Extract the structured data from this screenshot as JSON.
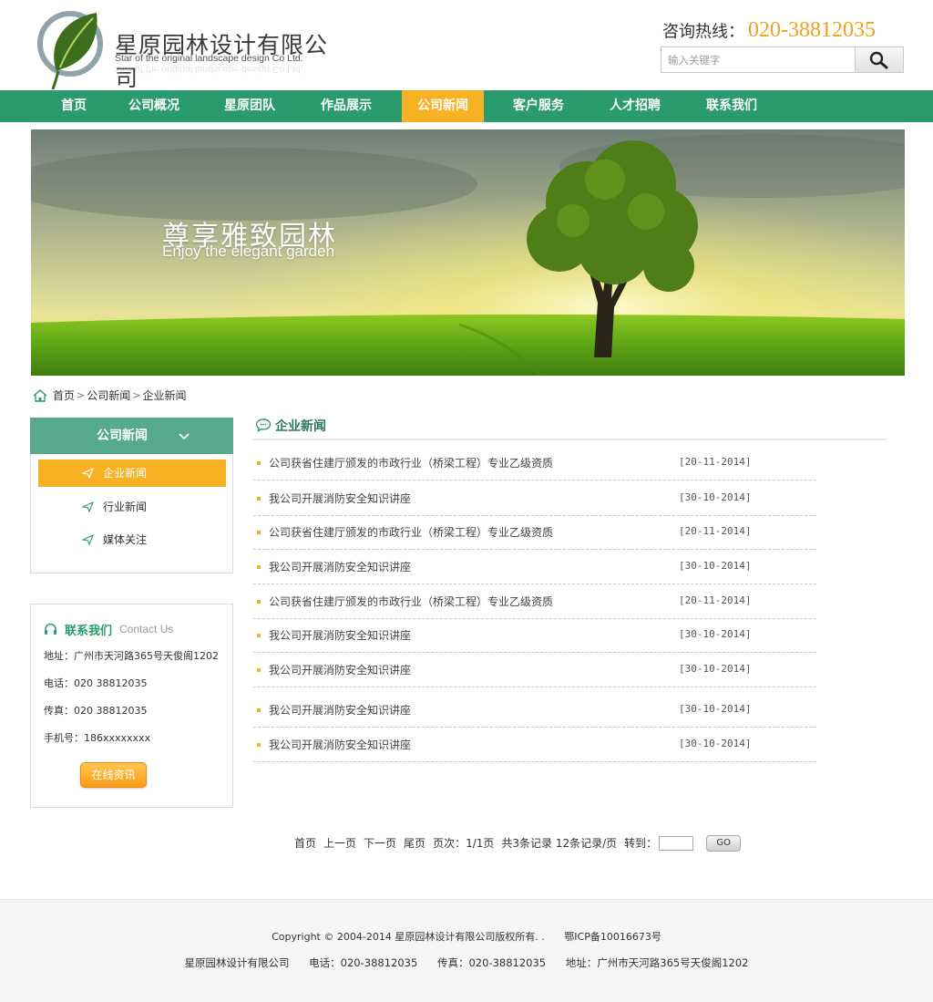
{
  "header": {
    "company_name": "星原园林设计有限公司",
    "company_name_en": "Star of the original landscape design Co Ltd.",
    "hotline_label": "咨询热线：",
    "hotline_number": "020-38812035",
    "search_placeholder": "输入关键字",
    "search_icon": "search-icon"
  },
  "nav": {
    "items": [
      {
        "label": "首页"
      },
      {
        "label": "公司概况"
      },
      {
        "label": "星原团队"
      },
      {
        "label": "作品展示"
      },
      {
        "label": "公司新闻"
      },
      {
        "label": "客户服务"
      },
      {
        "label": "人才招聘"
      },
      {
        "label": "联系我们"
      }
    ],
    "active_index": 4
  },
  "banner": {
    "title_cn": "尊享雅致园林",
    "title_en": "Enjoy the elegant garden"
  },
  "breadcrumb": {
    "items": [
      "首页",
      "公司新闻",
      "企业新闻"
    ]
  },
  "sidebar": {
    "category_title": "公司新闻",
    "categories": [
      {
        "label": "企业新闻"
      },
      {
        "label": "行业新闻"
      },
      {
        "label": "媒体关注"
      }
    ],
    "active_category": 0,
    "contact": {
      "title": "联系我们",
      "title_en": "Contact Us",
      "address": "地址：广州市天河路365号天俊阁1202",
      "phone": "电话：020 38812035",
      "fax": "传真：020 38812035",
      "mobile": "手机号：186xxxxxxxx",
      "consult_button": "在线资讯"
    }
  },
  "main": {
    "section_title": "企业新闻",
    "news": [
      {
        "title": "公司获省住建厅颁发的市政行业（桥梁工程）专业乙级资质",
        "date": "[20-11-2014]"
      },
      {
        "title": "我公司开展消防安全知识讲座",
        "date": "[30-10-2014]"
      },
      {
        "title": "公司获省住建厅颁发的市政行业（桥梁工程）专业乙级资质",
        "date": "[20-11-2014]"
      },
      {
        "title": "我公司开展消防安全知识讲座",
        "date": "[30-10-2014]"
      },
      {
        "title": "公司获省住建厅颁发的市政行业（桥梁工程）专业乙级资质",
        "date": "[20-11-2014]"
      },
      {
        "title": "我公司开展消防安全知识讲座",
        "date": "[30-10-2014]"
      },
      {
        "title": "我公司开展消防安全知识讲座",
        "date": "[30-10-2014]"
      },
      {
        "title": "我公司开展消防安全知识讲座",
        "date": "[30-10-2014]"
      },
      {
        "title": "我公司开展消防安全知识讲座",
        "date": "[30-10-2014]"
      }
    ]
  },
  "pagination": {
    "first": "首页",
    "prev": "上一页",
    "next": "下一页",
    "last": "尾页",
    "page_info": "页次：1/1页",
    "record_info": "共3条记录 12条记录/页",
    "goto_label": "转到：",
    "go_button": "GO"
  },
  "footer": {
    "copyright": "Copyright © 2004-2014  星原园林设计有限公司版权所有. .",
    "icp": "鄂ICP备10016673号",
    "company": "星原园林设计有限公司",
    "phone": "电话：020-38812035",
    "fax": "传真：020-38812035",
    "address": "地址：广州市天河路365号天俊阁1202"
  },
  "colors": {
    "brand_green": "#2a9b6c",
    "accent_orange": "#f7b224",
    "sidebar_green": "#56a98a"
  }
}
